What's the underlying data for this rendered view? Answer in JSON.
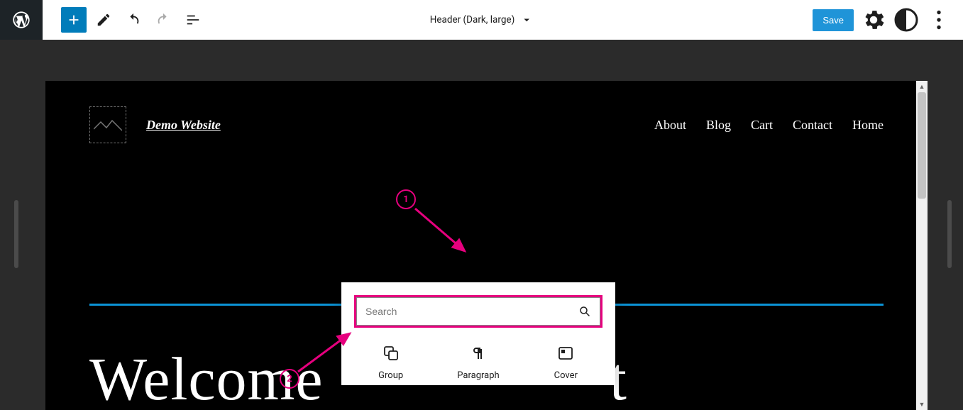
{
  "toolbar": {
    "template_label": "Header (Dark, large)",
    "save_label": "Save"
  },
  "site": {
    "title": "Demo Website",
    "nav": [
      "About",
      "Blog",
      "Cart",
      "Contact",
      "Home"
    ],
    "hero_left": "Welcome",
    "hero_right": "t"
  },
  "inserter": {
    "search_placeholder": "Search",
    "blocks": [
      {
        "name": "Group"
      },
      {
        "name": "Paragraph"
      },
      {
        "name": "Cover"
      }
    ]
  },
  "callouts": {
    "one": "1",
    "two": "2"
  }
}
